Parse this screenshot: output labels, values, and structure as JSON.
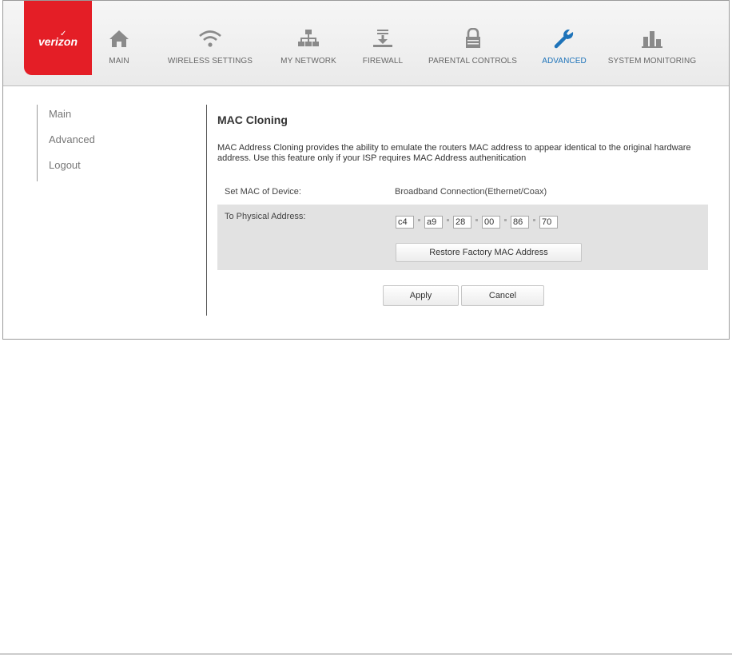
{
  "brand": {
    "logo_text": "verizon",
    "logo_color": "#e41e26"
  },
  "nav": {
    "items": [
      {
        "label": "MAIN",
        "icon": "home-icon"
      },
      {
        "label": "WIRELESS SETTINGS",
        "icon": "wifi-icon"
      },
      {
        "label": "MY NETWORK",
        "icon": "network-icon"
      },
      {
        "label": "FIREWALL",
        "icon": "firewall-icon"
      },
      {
        "label": "PARENTAL CONTROLS",
        "icon": "lock-icon"
      },
      {
        "label": "ADVANCED",
        "icon": "wrench-icon"
      },
      {
        "label": "SYSTEM MONITORING",
        "icon": "bar-chart-icon"
      }
    ],
    "active": "ADVANCED",
    "active_color": "#1e73b9"
  },
  "sidebar": {
    "items": [
      {
        "label": "Main"
      },
      {
        "label": "Advanced"
      },
      {
        "label": "Logout"
      }
    ]
  },
  "main": {
    "title": "MAC Cloning",
    "description": "MAC Address Cloning provides the ability to emulate the routers MAC address to appear identical to the original hardware address. Use this feature only if your ISP requires MAC Address authenitication",
    "set_mac_label": "Set MAC of Device:",
    "set_mac_value": "Broadband Connection(Ethernet/Coax)",
    "physical_label": "To Physical Address:",
    "mac_octets": [
      "c4",
      "a9",
      "28",
      "00",
      "86",
      "70"
    ],
    "restore_button": "Restore Factory MAC Address",
    "apply_button": "Apply",
    "cancel_button": "Cancel"
  }
}
